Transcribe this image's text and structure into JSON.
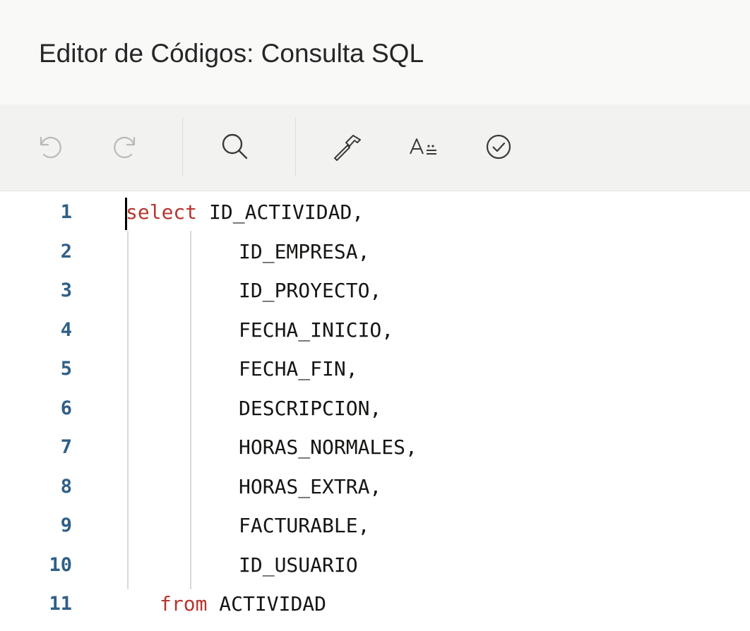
{
  "title": "Editor de Códigos: Consulta SQL",
  "toolbar": {
    "buttons": [
      {
        "name": "undo",
        "icon": "undo-icon"
      },
      {
        "name": "redo",
        "icon": "redo-icon"
      },
      {
        "name": "find",
        "icon": "search-icon"
      },
      {
        "name": "build",
        "icon": "hammer-icon"
      },
      {
        "name": "autocomplete",
        "icon": "text-format-icon"
      },
      {
        "name": "validate",
        "icon": "check-circle-icon"
      }
    ]
  },
  "editor": {
    "lines": [
      {
        "number": "1",
        "keyword": "select",
        "text": " ID_ACTIVIDAD,"
      },
      {
        "number": "2",
        "keyword": "",
        "text": "ID_EMPRESA,"
      },
      {
        "number": "3",
        "keyword": "",
        "text": "ID_PROYECTO,"
      },
      {
        "number": "4",
        "keyword": "",
        "text": "FECHA_INICIO,"
      },
      {
        "number": "5",
        "keyword": "",
        "text": "FECHA_FIN,"
      },
      {
        "number": "6",
        "keyword": "",
        "text": "DESCRIPCION,"
      },
      {
        "number": "7",
        "keyword": "",
        "text": "HORAS_NORMALES,"
      },
      {
        "number": "8",
        "keyword": "",
        "text": "HORAS_EXTRA,"
      },
      {
        "number": "9",
        "keyword": "",
        "text": "FACTURABLE,"
      },
      {
        "number": "10",
        "keyword": "",
        "text": "ID_USUARIO"
      },
      {
        "number": "11",
        "keyword": "from",
        "text": " ACTIVIDAD"
      }
    ]
  },
  "colors": {
    "keyword": "#b5362f",
    "line_number": "#2f5f87",
    "icon_disabled": "#b9b9b7",
    "icon_enabled": "#3a3a38"
  }
}
